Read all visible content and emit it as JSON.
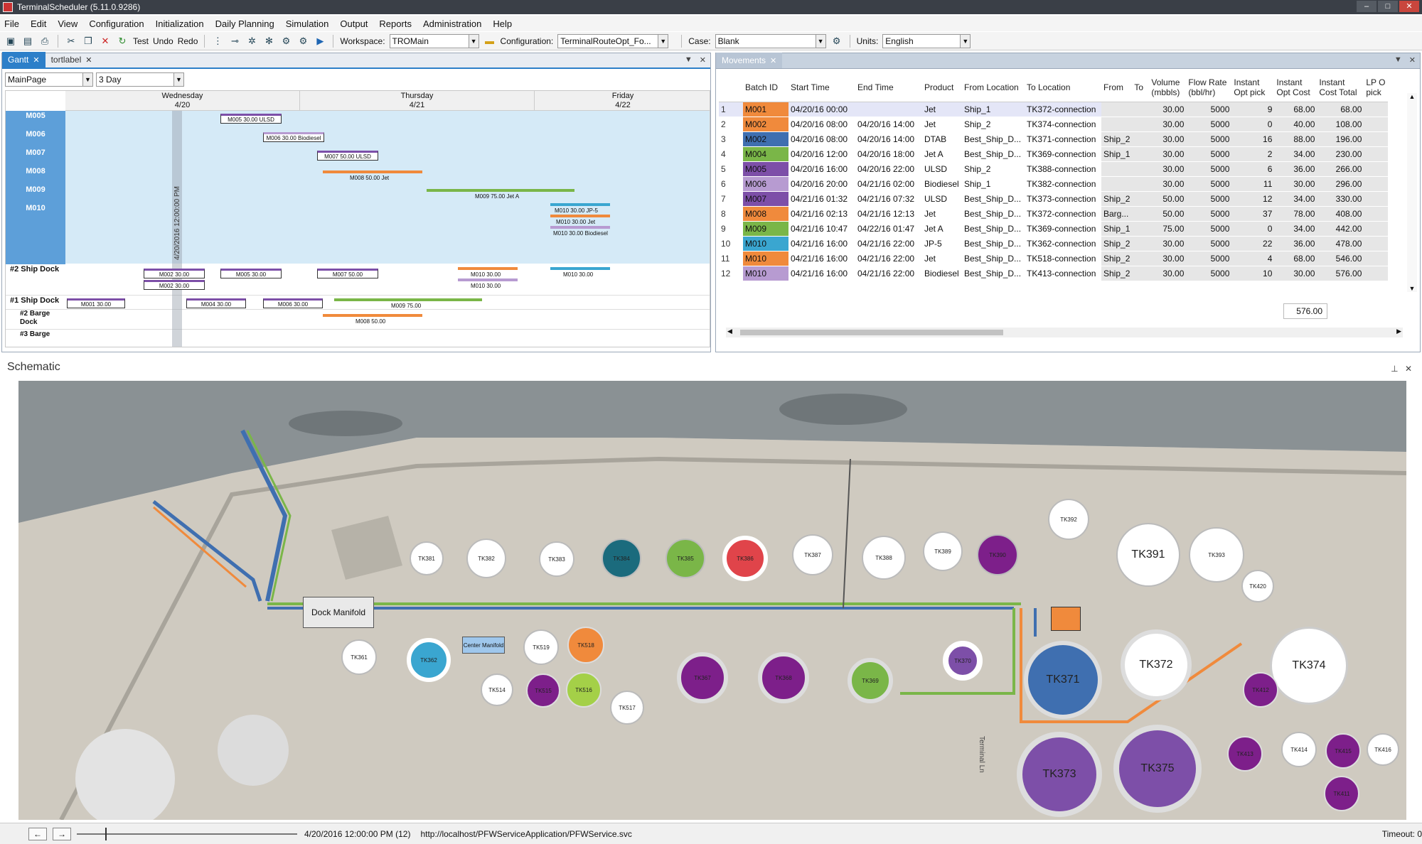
{
  "window": {
    "title": "TerminalScheduler (5.11.0.9286)",
    "btn_min": "–",
    "btn_max": "□",
    "btn_close": "✕"
  },
  "menu": [
    "File",
    "Edit",
    "View",
    "Configuration",
    "Initialization",
    "Daily Planning",
    "Simulation",
    "Output",
    "Reports",
    "Administration",
    "Help"
  ],
  "toolbar": {
    "test_label": "Test",
    "undo_label": "Undo",
    "redo_label": "Redo",
    "workspace_label": "Workspace:",
    "workspace_value": "TROMain",
    "configuration_label": "Configuration:",
    "configuration_value": "TerminalRouteOpt_Fo...",
    "case_label": "Case:",
    "case_value": "Blank",
    "units_label": "Units:",
    "units_value": "English"
  },
  "gantt_panel": {
    "tabs": [
      "Gantt",
      "tortlabel"
    ],
    "page_select": "MainPage",
    "range_select": "3 Day",
    "days": [
      {
        "name": "Wednesday",
        "date": "4/20"
      },
      {
        "name": "Thursday",
        "date": "4/21"
      },
      {
        "name": "Friday",
        "date": "4/22"
      }
    ],
    "now_label": "4/20/2016 12:00:00 PM",
    "vessel_rows": [
      "M005",
      "M006",
      "M007",
      "M008",
      "M009",
      "M010"
    ],
    "dock_rows": [
      "#2 Ship Dock",
      "#1 Ship Dock",
      "#2 Barge Dock",
      "#3 Barge"
    ],
    "bars": [
      {
        "label": "M005 30.00 ULSD"
      },
      {
        "label": "M006 30.00 Biodiesel"
      },
      {
        "label": "M007 50.00 ULSD"
      },
      {
        "label": "M008 50.00 Jet"
      },
      {
        "label": "M009 75.00 Jet A"
      },
      {
        "label": "M010 30.00 JP-5"
      },
      {
        "label": "M010 30.00 Jet"
      },
      {
        "label": "M010 30.00 Biodiesel"
      },
      {
        "label": "M002 30.00"
      },
      {
        "label": "M002 30.00"
      },
      {
        "label": "M005 30.00"
      },
      {
        "label": "M007 50.00"
      },
      {
        "label": "M010 30.00"
      },
      {
        "label": "M010 30.00"
      },
      {
        "label": "M010 30.00"
      },
      {
        "label": "M001 30.00"
      },
      {
        "label": "M004 30.00"
      },
      {
        "label": "M006 30.00"
      },
      {
        "label": "M009 75.00"
      },
      {
        "label": "M008 50.00"
      }
    ]
  },
  "movements_panel": {
    "tab": "Movements",
    "columns": [
      "",
      "Batch ID",
      "Start Time",
      "End Time",
      "Product",
      "From Location",
      "To Location",
      "From",
      "To",
      "Volume (mbbls)",
      "Flow Rate (bbl/hr)",
      "Instant Opt pick",
      "Instant Opt Cost",
      "Instant Cost Total",
      "LP O pick"
    ],
    "rows": [
      {
        "no": "1",
        "batch": "M001",
        "color": "#f08a3c",
        "start": "04/20/16 00:00",
        "end": "",
        "product": "Jet",
        "from_loc": "Ship_1",
        "to_loc": "TK372-connection",
        "from": "",
        "to": "",
        "volume": "30.00",
        "flow": "5000",
        "opt_pick": "9",
        "opt_cost": "68.00",
        "cost_total": "68.00"
      },
      {
        "no": "2",
        "batch": "M002",
        "color": "#f08a3c",
        "start": "04/20/16 08:00",
        "end": "04/20/16 14:00",
        "product": "Jet",
        "from_loc": "Ship_2",
        "to_loc": "TK374-connection",
        "from": "",
        "to": "",
        "volume": "30.00",
        "flow": "5000",
        "opt_pick": "0",
        "opt_cost": "40.00",
        "cost_total": "108.00"
      },
      {
        "no": "3",
        "batch": "M002",
        "color": "#3f6fb0",
        "start": "04/20/16 08:00",
        "end": "04/20/16 14:00",
        "product": "DTAB",
        "from_loc": "Best_Ship_D...",
        "to_loc": "TK371-connection",
        "from": "Ship_2",
        "to": "",
        "volume": "30.00",
        "flow": "5000",
        "opt_pick": "16",
        "opt_cost": "88.00",
        "cost_total": "196.00"
      },
      {
        "no": "4",
        "batch": "M004",
        "color": "#7ab648",
        "start": "04/20/16 12:00",
        "end": "04/20/16 18:00",
        "product": "Jet A",
        "from_loc": "Best_Ship_D...",
        "to_loc": "TK369-connection",
        "from": "Ship_1",
        "to": "",
        "volume": "30.00",
        "flow": "5000",
        "opt_pick": "2",
        "opt_cost": "34.00",
        "cost_total": "230.00"
      },
      {
        "no": "5",
        "batch": "M005",
        "color": "#7d4fa8",
        "start": "04/20/16 16:00",
        "end": "04/20/16 22:00",
        "product": "ULSD",
        "from_loc": "Ship_2",
        "to_loc": "TK388-connection",
        "from": "",
        "to": "",
        "volume": "30.00",
        "flow": "5000",
        "opt_pick": "6",
        "opt_cost": "36.00",
        "cost_total": "266.00"
      },
      {
        "no": "6",
        "batch": "M006",
        "color": "#b79bd1",
        "start": "04/20/16 20:00",
        "end": "04/21/16 02:00",
        "product": "Biodiesel",
        "from_loc": "Ship_1",
        "to_loc": "TK382-connection",
        "from": "",
        "to": "",
        "volume": "30.00",
        "flow": "5000",
        "opt_pick": "11",
        "opt_cost": "30.00",
        "cost_total": "296.00"
      },
      {
        "no": "7",
        "batch": "M007",
        "color": "#7d4fa8",
        "start": "04/21/16 01:32",
        "end": "04/21/16 07:32",
        "product": "ULSD",
        "from_loc": "Best_Ship_D...",
        "to_loc": "TK373-connection",
        "from": "Ship_2",
        "to": "",
        "volume": "50.00",
        "flow": "5000",
        "opt_pick": "12",
        "opt_cost": "34.00",
        "cost_total": "330.00"
      },
      {
        "no": "8",
        "batch": "M008",
        "color": "#f08a3c",
        "start": "04/21/16 02:13",
        "end": "04/21/16 12:13",
        "product": "Jet",
        "from_loc": "Best_Ship_D...",
        "to_loc": "TK372-connection",
        "from": "Barg...",
        "to": "",
        "volume": "50.00",
        "flow": "5000",
        "opt_pick": "37",
        "opt_cost": "78.00",
        "cost_total": "408.00"
      },
      {
        "no": "9",
        "batch": "M009",
        "color": "#7ab648",
        "start": "04/21/16 10:47",
        "end": "04/22/16 01:47",
        "product": "Jet A",
        "from_loc": "Best_Ship_D...",
        "to_loc": "TK369-connection",
        "from": "Ship_1",
        "to": "",
        "volume": "75.00",
        "flow": "5000",
        "opt_pick": "0",
        "opt_cost": "34.00",
        "cost_total": "442.00"
      },
      {
        "no": "10",
        "batch": "M010",
        "color": "#3aa6d0",
        "start": "04/21/16 16:00",
        "end": "04/21/16 22:00",
        "product": "JP-5",
        "from_loc": "Best_Ship_D...",
        "to_loc": "TK362-connection",
        "from": "Ship_2",
        "to": "",
        "volume": "30.00",
        "flow": "5000",
        "opt_pick": "22",
        "opt_cost": "36.00",
        "cost_total": "478.00"
      },
      {
        "no": "11",
        "batch": "M010",
        "color": "#f08a3c",
        "start": "04/21/16 16:00",
        "end": "04/21/16 22:00",
        "product": "Jet",
        "from_loc": "Best_Ship_D...",
        "to_loc": "TK518-connection",
        "from": "Ship_2",
        "to": "",
        "volume": "30.00",
        "flow": "5000",
        "opt_pick": "4",
        "opt_cost": "68.00",
        "cost_total": "546.00"
      },
      {
        "no": "12",
        "batch": "M010",
        "color": "#b79bd1",
        "start": "04/21/16 16:00",
        "end": "04/21/16 22:00",
        "product": "Biodiesel",
        "from_loc": "Best_Ship_D...",
        "to_loc": "TK413-connection",
        "from": "Ship_2",
        "to": "",
        "volume": "30.00",
        "flow": "5000",
        "opt_pick": "10",
        "opt_cost": "30.00",
        "cost_total": "576.00"
      }
    ],
    "total": "576.00"
  },
  "schematic": {
    "title": "Schematic",
    "dock_manifold": "Dock Manifold",
    "center_manifold": "Center Manifold",
    "road_label": "Terminal Ln",
    "tanks": [
      {
        "label": "TK391",
        "color": "#ffffff"
      },
      {
        "label": "TK393",
        "color": "#ffffff"
      },
      {
        "label": "TK371",
        "color": "#3f6fb0"
      },
      {
        "label": "TK372",
        "color": "#ffffff"
      },
      {
        "label": "TK374",
        "color": "#ffffff"
      },
      {
        "label": "TK373",
        "color": "#7d4fa8"
      },
      {
        "label": "TK375",
        "color": "#7d4fa8"
      },
      {
        "label": "TK367",
        "color": "#7d1f8a"
      },
      {
        "label": "TK368",
        "color": "#7d1f8a"
      },
      {
        "label": "TK369",
        "color": "#7ab648"
      },
      {
        "label": "TK370",
        "color": "#7d4fa8"
      },
      {
        "label": "TK386",
        "color": "#e0444a"
      },
      {
        "label": "TK387",
        "color": "#ffffff"
      },
      {
        "label": "TK388",
        "color": "#ffffff"
      },
      {
        "label": "TK389",
        "color": "#ffffff"
      },
      {
        "label": "TK390",
        "color": "#7d1f8a"
      },
      {
        "label": "TK392",
        "color": "#ffffff"
      },
      {
        "label": "TK385",
        "color": "#7ab648"
      },
      {
        "label": "TK384",
        "color": "#1b6b7d"
      },
      {
        "label": "TK383",
        "color": "#ffffff"
      },
      {
        "label": "TK382",
        "color": "#ffffff"
      },
      {
        "label": "TK381",
        "color": "#ffffff"
      },
      {
        "label": "TK362",
        "color": "#3aa6d0"
      },
      {
        "label": "TK361",
        "color": "#ffffff"
      },
      {
        "label": "TK518",
        "color": "#f08a3c"
      },
      {
        "label": "TK519",
        "color": "#ffffff"
      },
      {
        "label": "TK516",
        "color": "#a4d048"
      },
      {
        "label": "TK515",
        "color": "#7d1f8a"
      },
      {
        "label": "TK514",
        "color": "#ffffff"
      },
      {
        "label": "TK517",
        "color": "#ffffff"
      },
      {
        "label": "TK413",
        "color": "#7d1f8a"
      },
      {
        "label": "TK414",
        "color": "#ffffff"
      },
      {
        "label": "TK415",
        "color": "#7d1f8a"
      },
      {
        "label": "TK416",
        "color": "#ffffff"
      },
      {
        "label": "TK420",
        "color": "#ffffff"
      },
      {
        "label": "TK412",
        "color": "#7d1f8a"
      },
      {
        "label": "TK411",
        "color": "#7d1f8a"
      }
    ]
  },
  "statusbar": {
    "timestamp": "4/20/2016 12:00:00 PM (12)",
    "url": "http://localhost/PFWServiceApplication/PFWService.svc",
    "timeout": "Timeout: 0"
  }
}
